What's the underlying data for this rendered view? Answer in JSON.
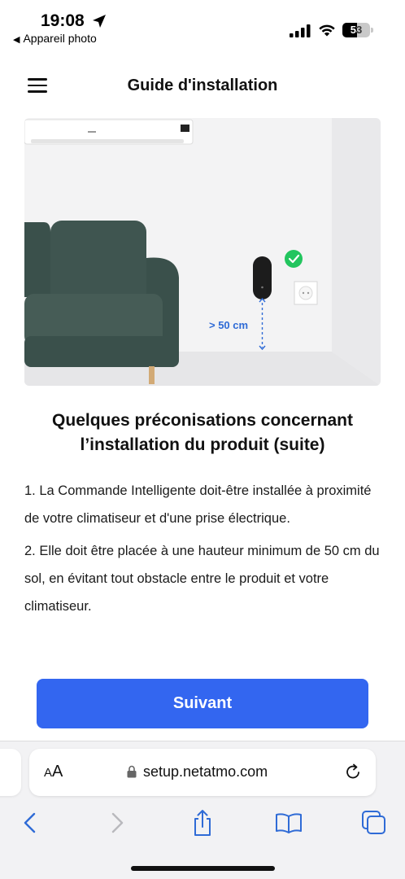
{
  "status_bar": {
    "time": "19:08",
    "back_app": "Appareil photo",
    "battery_percent": 53,
    "battery_label": "53"
  },
  "header": {
    "title": "Guide d'installation"
  },
  "illustration": {
    "distance_label": "> 50 cm",
    "accent_color": "#2f6bd6",
    "check_color": "#22c55e",
    "sofa_color": "#3f5550"
  },
  "main": {
    "section_title": "Quelques préconisations concernant l’installation du produit (suite)",
    "paragraphs": [
      "1. La Commande Intelligente doit-être installée à proximité de votre climatiseur et d'une prise électrique.",
      "2. Elle doit être placée à une hauteur minimum de 50 cm du sol, en évitant tout obstacle entre le produit et votre climatiseur."
    ],
    "next_button": "Suivant",
    "button_color": "#3366f0"
  },
  "browser": {
    "text_size_label_small": "A",
    "text_size_label_large": "A",
    "url": "setup.netatmo.com",
    "toolbar_icons": [
      "back-icon",
      "forward-icon",
      "share-icon",
      "bookmarks-icon",
      "tabs-icon"
    ]
  }
}
